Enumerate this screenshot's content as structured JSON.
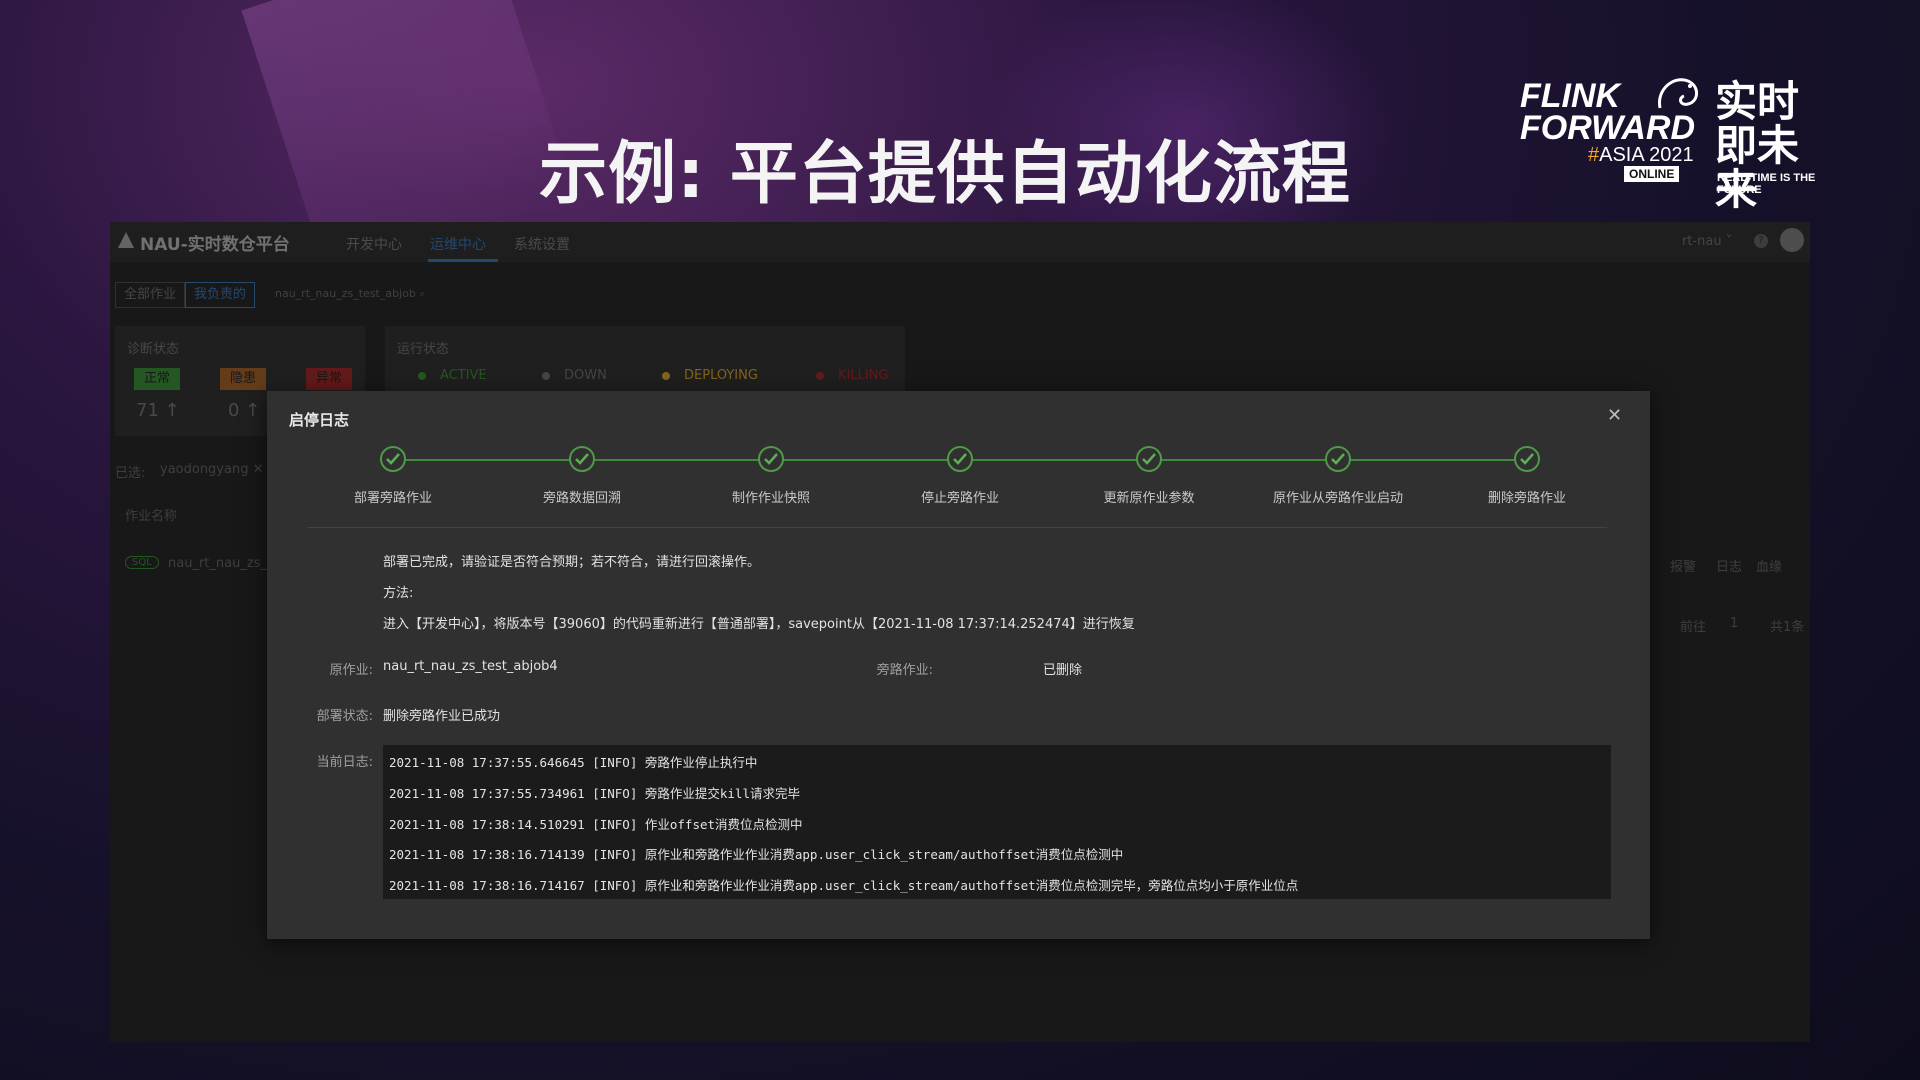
{
  "slide_title": "示例: 平台提供自动化流程",
  "logo": {
    "line1": "FLINK",
    "line2": "FORWARD",
    "hash": "#",
    "asia": "ASIA 2021",
    "online": "ONLINE",
    "cn1": "实时",
    "cn2": "即未来",
    "en": "REAL-TIME IS THE FUTURE"
  },
  "app": {
    "brand": "NAU-实时数仓平台",
    "nav": [
      "开发中心",
      "运维中心",
      "系统设置"
    ],
    "user": "rt-nau",
    "help": "?",
    "filters": [
      "全部作业",
      "我负责的"
    ],
    "search_placeholder": "nau_rt_nau_zs_test_abjob",
    "diag_title": "诊断状态",
    "diag_tags": [
      {
        "label": "正常",
        "color": "#2e6b2a",
        "count": "71"
      },
      {
        "label": "隐患",
        "color": "#7a4a1f",
        "count": "0"
      },
      {
        "label": "异常",
        "color": "#7a2020",
        "count": ""
      }
    ],
    "run_title": "运行状态",
    "run_states": [
      {
        "label": "ACTIVE",
        "color": "#2e6b2a"
      },
      {
        "label": "DOWN",
        "color": "#555555"
      },
      {
        "label": "DEPLOYING",
        "color": "#a07a20"
      },
      {
        "label": "KILLING",
        "color": "#7a2020"
      }
    ],
    "selected_label": "已选:",
    "selected_user": "yaodongyang",
    "col_job_name": "作业名称",
    "row_tag": "SQL",
    "row_job": "nau_rt_nau_zs_t",
    "row_actions": [
      "报警",
      "日志",
      "血缘"
    ],
    "pager": [
      "前往",
      "1",
      "共1条"
    ]
  },
  "modal": {
    "title": "启停日志",
    "steps": [
      "部署旁路作业",
      "旁路数据回溯",
      "制作作业快照",
      "停止旁路作业",
      "更新原作业参数",
      "原作业从旁路作业启动",
      "删除旁路作业"
    ],
    "message": "部署已完成，请验证是否符合预期；若不符合，请进行回滚操作。",
    "method_label": "方法:",
    "method_text": "进入【开发中心】，将版本号【39060】的代码重新进行【普通部署】，savepoint从【2021-11-08 17:37:14.252474】进行恢复",
    "orig_job_label": "原作业:",
    "orig_job": "nau_rt_nau_zs_test_abjob4",
    "bypass_job_label": "旁路作业:",
    "bypass_job": "已删除",
    "deploy_status_label": "部署状态:",
    "deploy_status": "删除旁路作业已成功",
    "current_log_label": "当前日志:",
    "logs": [
      "2021-11-08 17:37:55.646645 [INFO] 旁路作业停止执行中",
      "2021-11-08 17:37:55.734961 [INFO] 旁路作业提交kill请求完毕",
      "2021-11-08 17:38:14.510291 [INFO] 作业offset消费位点检测中",
      "2021-11-08 17:38:16.714139 [INFO] 原作业和旁路作业作业消费app.user_click_stream/authoffset消费位点检测中",
      "2021-11-08 17:38:16.714167 [INFO] 原作业和旁路作业作业消费app.user_click_stream/authoffset消费位点检测完毕，旁路位点均小于原作业位点"
    ]
  }
}
